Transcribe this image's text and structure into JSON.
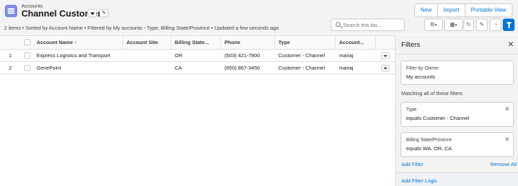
{
  "header": {
    "object_name": "Accounts",
    "list_view_name": "Channel Customers",
    "summary": "2 items • Sorted by Account Name • Filtered by My accounts - Type, Billing State/Province • Updated a few seconds ago",
    "actions": [
      "New",
      "Import",
      "Printable View"
    ],
    "search_placeholder": "Search this list...",
    "toolbar_icons": [
      "list-settings-icon",
      "display-as-table-icon",
      "refresh-icon",
      "edit-list-icon",
      "charts-icon",
      "filter-icon"
    ]
  },
  "table": {
    "columns": [
      "Account Name ↑",
      "Account Site",
      "Billing State...",
      "Phone",
      "Type",
      "Account..."
    ],
    "rows": [
      {
        "num": "1",
        "account_name": "Express Logistics and Transport",
        "account_site": "",
        "billing_state": "OR",
        "phone": "(503) 421-7800",
        "type": "Customer - Channel",
        "owner": "mariaj"
      },
      {
        "num": "2",
        "account_name": "GenePoint",
        "account_site": "",
        "billing_state": "CA",
        "phone": "(650) 867-3450",
        "type": "Customer - Channel",
        "owner": "mariaj"
      }
    ]
  },
  "filters": {
    "title": "Filters",
    "owner_filter": {
      "label": "Filter by Owner",
      "value": "My accounts"
    },
    "matching_label": "Matching all of these filters",
    "items": [
      {
        "field": "Type",
        "condition": "equals  Customer - Channel"
      },
      {
        "field": "Billing State/Province",
        "condition": "equals  WA, OR, CA"
      }
    ],
    "add_filter": "Add Filter",
    "remove_all": "Remove All",
    "add_filter_logic": "Add Filter Logic"
  },
  "colors": {
    "accent": "#0176d3",
    "object_icon": "#7f8de1",
    "link": "#0b5cab"
  }
}
